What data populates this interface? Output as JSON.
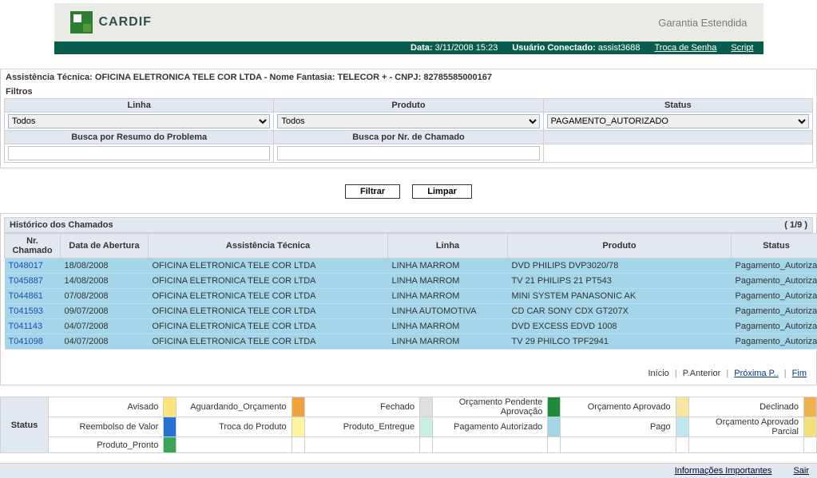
{
  "brand": {
    "name": "CARDIF",
    "tagline": "Garantia Estendida"
  },
  "topbar": {
    "date_label": "Data:",
    "date_value": "3/11/2008 15:23",
    "user_label": "Usuário Conectado:",
    "user_value": "assist3688",
    "change_pw": "Troca de Senha",
    "script": "Script"
  },
  "assist": {
    "prefix": "Assistência Técnica:",
    "name": "OFICINA ELETRONICA TELE COR LTDA",
    "sep1": "- Nome Fantasia:",
    "fantasy": "TELECOR +",
    "sep2": "- CNPJ:",
    "cnpj": "82785585000167"
  },
  "filters": {
    "section": "Filtros",
    "col_linha": "Linha",
    "col_produto": "Produto",
    "col_status": "Status",
    "col_resumo": "Busca por Resumo do Problema",
    "col_nrcham": "Busca por Nr. de Chamado",
    "linha_value": "Todos",
    "produto_value": "Todos",
    "status_value": "PAGAMENTO_AUTORIZADO",
    "resumo_value": "",
    "nrcham_value": ""
  },
  "buttons": {
    "filtrar": "Filtrar",
    "limpar": "Limpar"
  },
  "history": {
    "title": "Histórico dos Chamados",
    "page_indicator": "( 1/9 )",
    "cols": {
      "nr": "Nr. Chamado",
      "data": "Data de Abertura",
      "assist": "Assistência Técnica",
      "linha": "Linha",
      "produto": "Produto",
      "status": "Status"
    },
    "rows": [
      {
        "nr": "T048017",
        "data": "18/08/2008",
        "assist": "OFICINA ELETRONICA TELE COR LTDA",
        "linha": "LINHA MARROM",
        "produto": "DVD PHILIPS DVP3020/78",
        "status": "Pagamento_Autorizado"
      },
      {
        "nr": "T045887",
        "data": "14/08/2008",
        "assist": "OFICINA ELETRONICA TELE COR LTDA",
        "linha": "LINHA MARROM",
        "produto": "TV 21 PHILIPS 21 PT543",
        "status": "Pagamento_Autorizado"
      },
      {
        "nr": "T044861",
        "data": "07/08/2008",
        "assist": "OFICINA ELETRONICA TELE COR LTDA",
        "linha": "LINHA MARROM",
        "produto": "MINI SYSTEM PANASONIC AK",
        "status": "Pagamento_Autorizado"
      },
      {
        "nr": "T041593",
        "data": "09/07/2008",
        "assist": "OFICINA ELETRONICA TELE COR LTDA",
        "linha": "LINHA AUTOMOTIVA",
        "produto": "CD CAR SONY CDX GT207X",
        "status": "Pagamento_Autorizado"
      },
      {
        "nr": "T041143",
        "data": "04/07/2008",
        "assist": "OFICINA ELETRONICA TELE COR LTDA",
        "linha": "LINHA MARROM",
        "produto": "DVD EXCESS EDVD 1008",
        "status": "Pagamento_Autorizado"
      },
      {
        "nr": "T041098",
        "data": "04/07/2008",
        "assist": "OFICINA ELETRONICA TELE COR LTDA",
        "linha": "LINHA MARROM",
        "produto": "TV 29 PHILCO TPF2941",
        "status": "Pagamento_Autorizado"
      }
    ]
  },
  "pager": {
    "inicio": "Início",
    "prev": "P.Anterior",
    "next": "Próxima P..",
    "fim": "Fim"
  },
  "legend": {
    "head": "Status",
    "items": [
      {
        "label": "Avisado",
        "color": "#ffe27a"
      },
      {
        "label": "Aguardando_Orçamento",
        "color": "#f0a23c"
      },
      {
        "label": "Fechado",
        "color": "#dedede"
      },
      {
        "label": "Orçamento Pendente Aprovação",
        "color": "#1e8b3a"
      },
      {
        "label": "Orçamento Aprovado",
        "color": "#f8e6a0"
      },
      {
        "label": "Declinado",
        "color": "#f0b050"
      },
      {
        "label": "Reembolso de Valor",
        "color": "#2a6fd6"
      },
      {
        "label": "Troca do Produto",
        "color": "#fff3a0"
      },
      {
        "label": "Produto_Entregue",
        "color": "#c6f0df"
      },
      {
        "label": "Pagamento Autorizado",
        "color": "#a4d5e8"
      },
      {
        "label": "Pago",
        "color": "#bfe8ef"
      },
      {
        "label": "Orçamento Aprovado Parcial",
        "color": "#f4e07a"
      },
      {
        "label": "Produto_Pronto",
        "color": "#3aa655"
      }
    ]
  },
  "footer": {
    "info": "Informações Importantes",
    "sair": "Sair"
  }
}
